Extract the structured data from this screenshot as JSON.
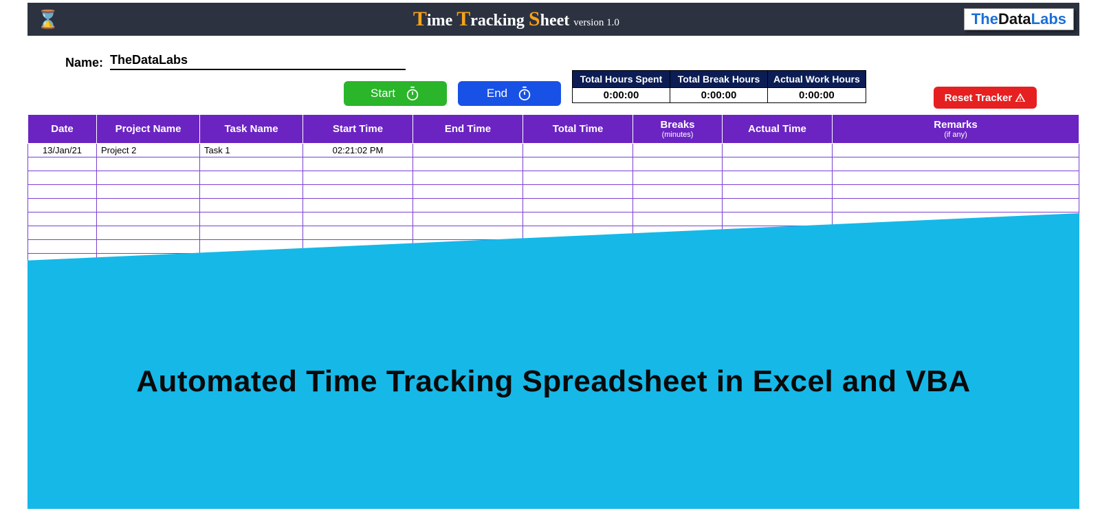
{
  "header": {
    "title_parts": {
      "T1": "T",
      "ime": "ime ",
      "T2": "T",
      "racking": "racking ",
      "S": "S",
      "heet": "heet ",
      "ver": "version 1.0"
    },
    "logo": {
      "the": "The",
      "data": "Data",
      "labs": "Labs"
    }
  },
  "name": {
    "label": "Name:",
    "value": "TheDataLabs"
  },
  "buttons": {
    "start": "Start",
    "end": "End",
    "reset": "Reset Tracker"
  },
  "summary": {
    "headers": [
      "Total Hours Spent",
      "Total Break Hours",
      "Actual Work Hours"
    ],
    "values": [
      "0:00:00",
      "0:00:00",
      "0:00:00"
    ]
  },
  "grid": {
    "headers": {
      "date": "Date",
      "project": "Project Name",
      "task": "Task Name",
      "start": "Start Time",
      "end": "End Time",
      "total": "Total Time",
      "breaks": "Breaks",
      "breaks_sub": "(minutes)",
      "actual": "Actual Time",
      "remarks": "Remarks",
      "remarks_sub": "(if any)"
    },
    "rows": [
      {
        "date": "13/Jan/21",
        "project": "Project 2",
        "task": "Task 1",
        "start": "02:21:02 PM",
        "end": "",
        "total": "",
        "breaks": "",
        "actual": "",
        "remarks": ""
      },
      {
        "date": "",
        "project": "",
        "task": "",
        "start": "",
        "end": "",
        "total": "",
        "breaks": "",
        "actual": "",
        "remarks": ""
      },
      {
        "date": "",
        "project": "",
        "task": "",
        "start": "",
        "end": "",
        "total": "",
        "breaks": "",
        "actual": "",
        "remarks": ""
      },
      {
        "date": "",
        "project": "",
        "task": "",
        "start": "",
        "end": "",
        "total": "",
        "breaks": "",
        "actual": "",
        "remarks": ""
      },
      {
        "date": "",
        "project": "",
        "task": "",
        "start": "",
        "end": "",
        "total": "",
        "breaks": "",
        "actual": "",
        "remarks": ""
      },
      {
        "date": "",
        "project": "",
        "task": "",
        "start": "",
        "end": "",
        "total": "",
        "breaks": "",
        "actual": "",
        "remarks": ""
      },
      {
        "date": "",
        "project": "",
        "task": "",
        "start": "",
        "end": "",
        "total": "",
        "breaks": "",
        "actual": "",
        "remarks": ""
      },
      {
        "date": "",
        "project": "",
        "task": "",
        "start": "",
        "end": "",
        "total": "",
        "breaks": "",
        "actual": "",
        "remarks": ""
      },
      {
        "date": "",
        "project": "",
        "task": "",
        "start": "",
        "end": "",
        "total": "",
        "breaks": "",
        "actual": "",
        "remarks": ""
      },
      {
        "date": "",
        "project": "",
        "task": "",
        "start": "",
        "end": "",
        "total": "",
        "breaks": "",
        "actual": "",
        "remarks": ""
      }
    ],
    "selected_cell": {
      "row": 8,
      "col": "end"
    }
  },
  "banner": {
    "text": "Automated Time Tracking Spreadsheet in Excel and VBA"
  }
}
